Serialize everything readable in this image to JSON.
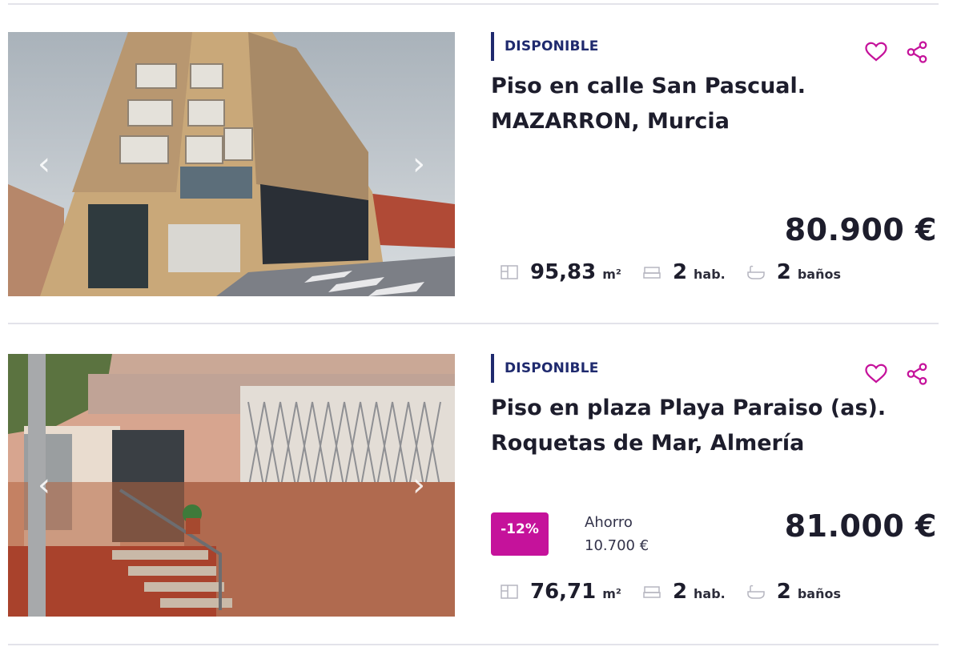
{
  "listings": [
    {
      "status": "DISPONIBLE",
      "title_line1": "Piso en calle San Pascual.",
      "title_line2": "MAZARRON, Murcia",
      "price": "80.900 €",
      "area_value": "95,83",
      "area_unit": "m²",
      "rooms_value": "2",
      "rooms_unit": "hab.",
      "baths_value": "2",
      "baths_unit": "baños",
      "photo_prev_glyph": "‹",
      "photo_next_glyph": "›"
    },
    {
      "status": "DISPONIBLE",
      "title_line1": "Piso en plaza Playa Paraiso (as).",
      "title_line2": "Roquetas de Mar, Almería",
      "discount": "-12%",
      "savings_label": "Ahorro",
      "savings_value": "10.700 €",
      "price": "81.000 €",
      "area_value": "76,71",
      "area_unit": "m²",
      "rooms_value": "2",
      "rooms_unit": "hab.",
      "baths_value": "2",
      "baths_unit": "baños",
      "photo_prev_glyph": "‹",
      "photo_next_glyph": "›"
    }
  ],
  "icons": {
    "favorite": "heart-icon",
    "share": "share-icon",
    "area": "floorplan-icon",
    "rooms": "bed-icon",
    "baths": "bathtub-icon"
  },
  "colors": {
    "accent": "#c5129b",
    "status_bar": "#1f2a6e",
    "text": "#1d1d2c",
    "divider": "#e3e3ea"
  }
}
